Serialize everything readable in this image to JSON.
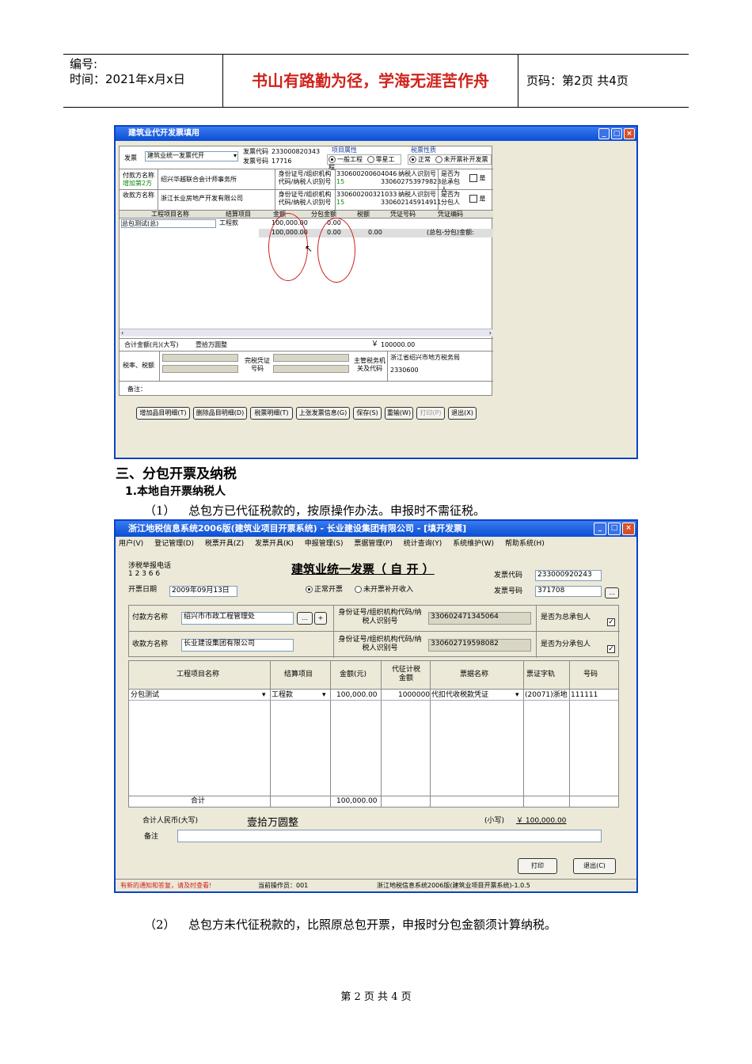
{
  "header": {
    "number_label": "编号:",
    "time_label": "时间：2021年x月x日",
    "motto": "书山有路勤为径，学海无涯苦作舟",
    "page_label": "页码：第2页  共4页"
  },
  "window1": {
    "title": "建筑业代开发票填用",
    "invoice_label": "发票",
    "invoice_type": "建筑业统一发票代开",
    "code_label": "发票代码",
    "code_value": "233000820343",
    "number_label": "发票号码",
    "number_value": "17716",
    "project_attr_label": "项目属性",
    "attr_general": "一般工程",
    "attr_scattered": "零星工程",
    "tax_nature_label": "税票性质",
    "tax_normal": "正常",
    "tax_supp": "未开票补开发票",
    "payer_label": "付款方名称",
    "payer_extra": "增加第2方",
    "payer_name": "绍兴华越联合会计师事务所",
    "payer_id_label": "身份证号/组织机构代码/纳税人识别号",
    "payer_id": "330600200604046",
    "payer_id2": "15",
    "payer_tax_label": "纳税人识别号",
    "payer_tax": "330602753979823",
    "payer_main_label": "是否为总承包人",
    "yes": "是",
    "payee_label": "收款方名称",
    "payee_name": "浙江长业房地产开发有限公司",
    "payee_id_label": "身份证号/组织机构代码/纳税人识别号",
    "payee_id": "330600200321033",
    "payee_id2": "15",
    "payee_tax_label": "纳税人识别号",
    "payee_tax": "330602145914911",
    "payee_sub_label": "是否为分包人",
    "cols": [
      "工程项目名称",
      "结算项目",
      "金额",
      "分包金额",
      "税额",
      "凭证号码",
      "凭证编码"
    ],
    "row1": {
      "name": "总包测试(总)",
      "item": "工程款",
      "amount": "100,000.00",
      "sub": "0.00"
    },
    "row2": {
      "amount": "100,000.00",
      "sub": "0.00",
      "tax": "0.00",
      "note": "(总包-分包)金额:"
    },
    "total_label": "合计金额(元)(大写)",
    "total_words": "壹拾万圆整",
    "total_symbol": "￥",
    "total_num": "100000.00",
    "tax_rate_label": "税率、税额",
    "voucher_label": "完税凭证号码",
    "authority_label": "主管税务机关及代码",
    "authority_name": "浙江省绍兴市地方税务局",
    "authority_code": "2330600",
    "remark_label": "备注：",
    "buttons": [
      "增加品目明细(T)",
      "删除品目明细(D)",
      "税票明细(T)",
      "上张发票信息(G)",
      "保存(S)",
      "重输(W)",
      "打印(P)",
      "退出(X)"
    ]
  },
  "section3": "三、分包开票及纳税",
  "section3_1": "1.本地自开票纳税人",
  "para1_num": "（1）",
  "para1_text": "总包方已代征税款的，按原操作办法。申报时不需征税。",
  "window2": {
    "title": "浙江地税信息系统2006版(建筑业项目开票系统) - 长业建设集团有限公司 - [填开发票]",
    "menu": [
      "用户(V)",
      "登记管理(D)",
      "税票开具(Z)",
      "发票开具(K)",
      "申报管理(S)",
      "票据管理(P)",
      "统计查询(Y)",
      "系统维护(W)",
      "帮助系统(H)"
    ],
    "phone_label": "涉税举报电话",
    "phone": "1 2 3 6 6",
    "heading": "建筑业统一发票（ 自  开 ）",
    "code_label": "发票代码",
    "code_value": "233000920243",
    "date_label": "开票日期",
    "date_value": "2009年09月13日",
    "opt_normal": "正常开票",
    "opt_supp": "未开票补开收入",
    "number_label": "发票号码",
    "number_value": "371708",
    "more": "...",
    "payer_label": "付款方名称",
    "payer_name": "绍兴市市政工程管理处",
    "plus": "+",
    "id_label": "身份证号/组织机构代码/纳税人识别号",
    "payer_id": "330602471345064",
    "main_label": "是否为总承包人",
    "payee_label": "收款方名称",
    "payee_name": "长业建设集团有限公司",
    "payee_id": "330602719598082",
    "sub_label": "是否为分承包人",
    "cols": [
      "工程项目名称",
      "结算项目",
      "金额(元)",
      "代征计税金额",
      "票据名称",
      "票证字轨",
      "号码"
    ],
    "row": {
      "name": "分包测试",
      "item": "工程款",
      "amount": "100,000.00",
      "levy": "1000000",
      "doc": "代扣代收税款凭证",
      "track": "(20071)浙地",
      "num": "111111"
    },
    "sum_label": "合计",
    "sum_value": "100,000.00",
    "rmb_label": "合计人民币(大写)",
    "rmb_words": "壹拾万圆整",
    "small_label": "(小写)",
    "small_value": "￥ 100,000.00",
    "remark_label": "备注",
    "print_btn": "打印",
    "exit_btn": "退出(C)",
    "status_notice": "有新的通知和答复，请及时查看!",
    "status_operator": "当前操作员：001",
    "status_version": "浙江地税信息系统2006版(建筑业项目开票系统)-1.0.5"
  },
  "para2_num": "（2）",
  "para2_text": "总包方未代征税款的，比照原总包开票，申报时分包金额须计算纳税。",
  "footer": "第 2 页 共 4 页"
}
